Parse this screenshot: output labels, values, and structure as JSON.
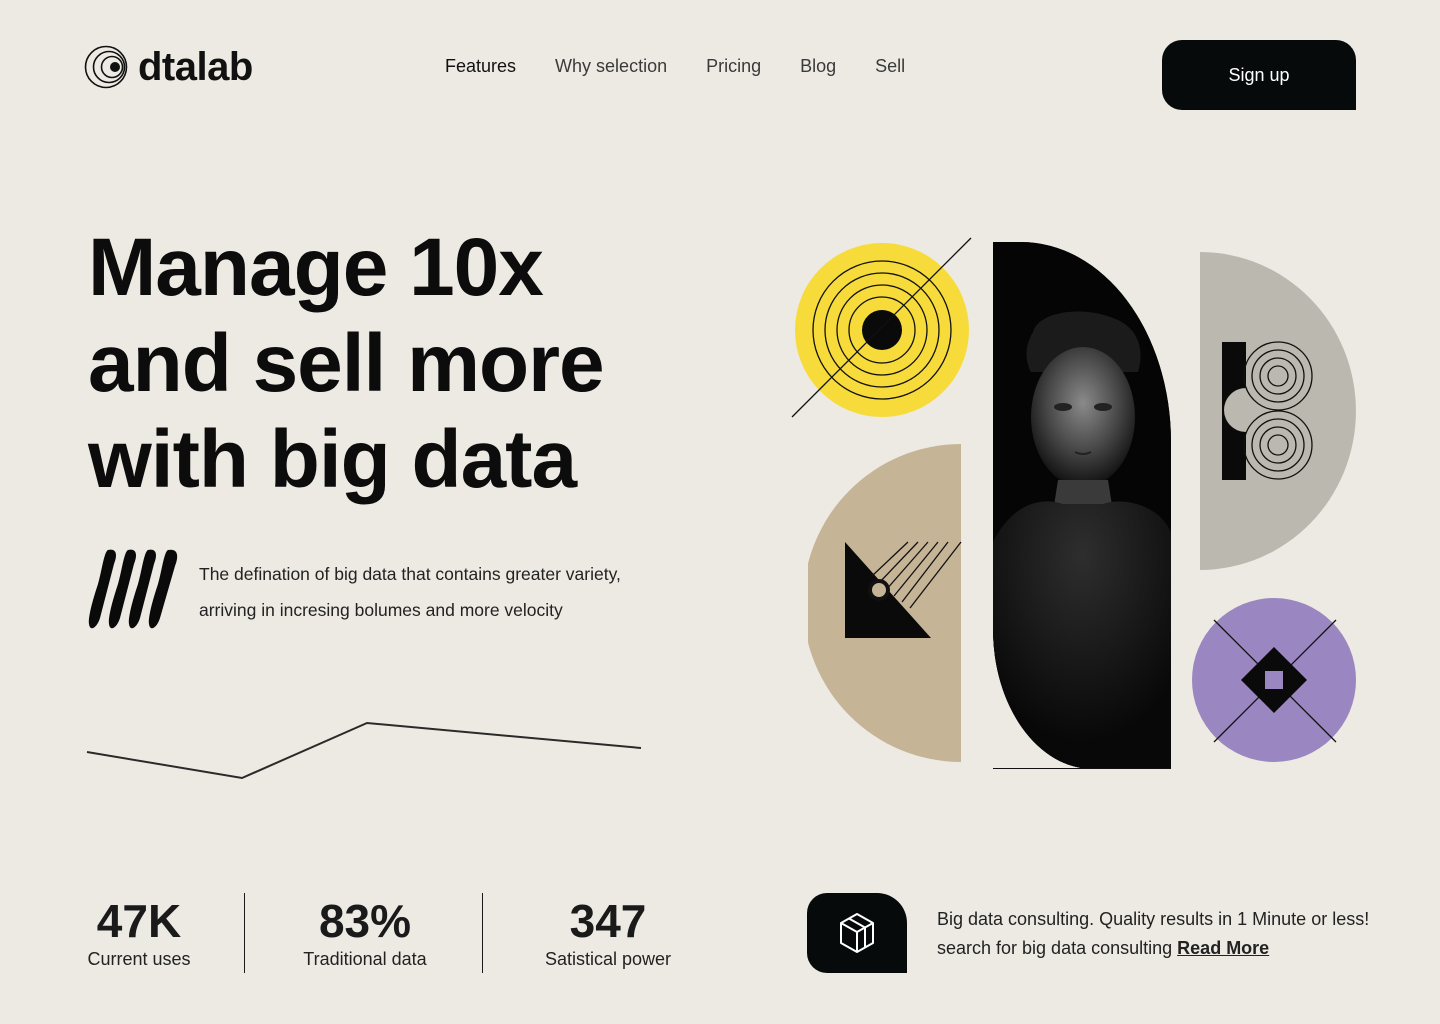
{
  "brand": {
    "name": "dtalab"
  },
  "nav": {
    "items": [
      {
        "label": "Features",
        "active": true
      },
      {
        "label": "Why selection",
        "active": false
      },
      {
        "label": "Pricing",
        "active": false
      },
      {
        "label": "Blog",
        "active": false
      },
      {
        "label": "Sell",
        "active": false
      }
    ],
    "signup_label": "Sign up"
  },
  "hero": {
    "headline": [
      "Manage 10x",
      "and sell more",
      "with big data"
    ],
    "description": [
      "The defination of big data that contains greater variety,",
      "arriving in incresing bolumes and more velocity"
    ]
  },
  "stats": [
    {
      "value": "47K",
      "label": "Current uses"
    },
    {
      "value": "83%",
      "label": "Traditional data"
    },
    {
      "value": "347",
      "label": "Satistical power"
    }
  ],
  "consult": {
    "text": "Big data consulting. Quality results in 1 Minute or less! search for big data consulting",
    "link_label": "Read More",
    "icon": "cube-icon"
  },
  "colors": {
    "background": "#EDEAE3",
    "dark": "#070A0B",
    "yellow": "#F7DB3A",
    "tan": "#C6B497",
    "gray": "#BBB8AF",
    "purple": "#9A86C0"
  }
}
